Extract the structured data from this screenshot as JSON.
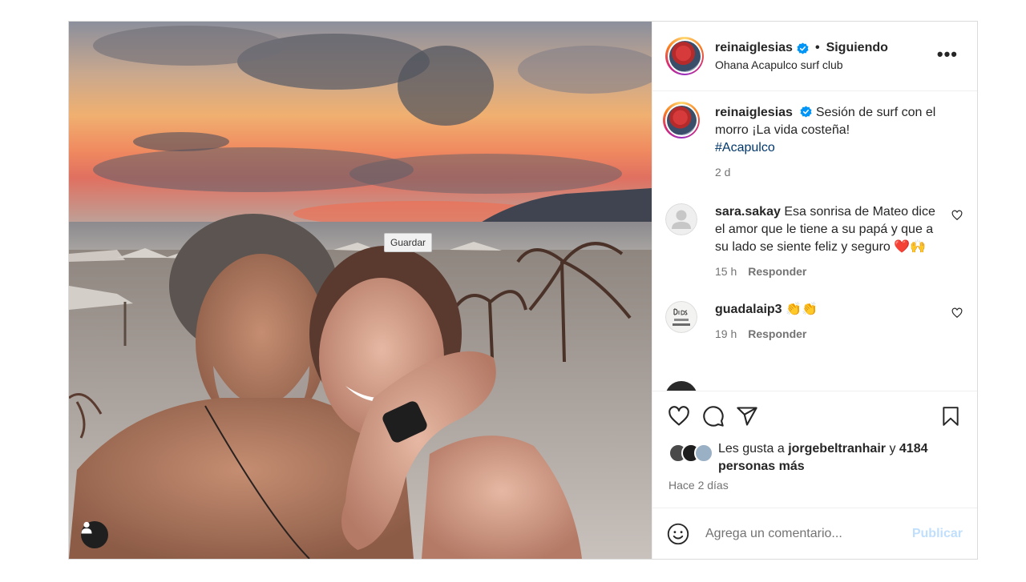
{
  "media": {
    "tooltip": "Guardar",
    "user_tag_icon": "user-tag-icon"
  },
  "header": {
    "username": "reinaiglesias",
    "separator": "•",
    "follow_status": "Siguiendo",
    "location": "Ohana Acapulco surf club",
    "more_label": "•••"
  },
  "caption": {
    "username": "reinaiglesias",
    "text": "Sesión de surf con el morro ¡La vida costeña!",
    "hashtag": "#Acapulco",
    "time": "2 d"
  },
  "comments": [
    {
      "username": "sara.sakay",
      "text": "Esa sonrisa de Mateo dice el amor que le tiene a su papá y que a su lado se siente feliz y seguro ❤️🙌",
      "time": "15 h",
      "reply_label": "Responder"
    },
    {
      "username": "guadalaip3",
      "text": "👏👏",
      "time": "19 h",
      "reply_label": "Responder"
    }
  ],
  "likes": {
    "prefix": "Les gusta a",
    "user": "jorgebeltranhair",
    "connector": "y",
    "others": "4184 personas más"
  },
  "post_date": "Hace 2 días",
  "comment_box": {
    "placeholder": "Agrega un comentario...",
    "publish_label": "Publicar"
  },
  "colors": {
    "verified": "#0095f6",
    "publish_disabled": "#c0dffd",
    "hashtag": "#00376b"
  }
}
